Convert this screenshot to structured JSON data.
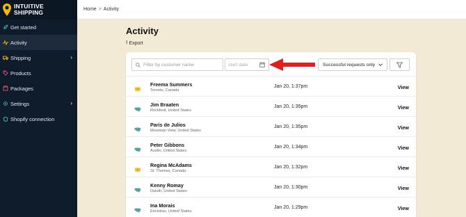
{
  "brand": {
    "line1": "INTUITIVE",
    "line2": "SHIPPING",
    "logo_icon": "location-pin-icon",
    "accent": "#f5b800"
  },
  "sidebar": {
    "items": [
      {
        "label": "Get started",
        "icon": "rocket-icon",
        "active": false,
        "chevron": false
      },
      {
        "label": "Activity",
        "icon": "activity-icon",
        "active": true,
        "chevron": false
      },
      {
        "label": "Shipping",
        "icon": "truck-icon",
        "active": false,
        "chevron": true
      },
      {
        "label": "Products",
        "icon": "tag-icon",
        "active": false,
        "chevron": false
      },
      {
        "label": "Packages",
        "icon": "box-icon",
        "active": false,
        "chevron": false
      },
      {
        "label": "Settings",
        "icon": "gear-icon",
        "active": false,
        "chevron": true
      },
      {
        "label": "Shopify connection",
        "icon": "shopify-icon",
        "active": false,
        "chevron": false
      }
    ]
  },
  "breadcrumb": {
    "home": "Home",
    "separator": ">",
    "current": "Activity"
  },
  "page": {
    "title": "Activity",
    "export_label": "Export"
  },
  "filters": {
    "search_placeholder": "Filter by customer name",
    "date_placeholder": "start date",
    "status_selected": "Successful requests only"
  },
  "rows": [
    {
      "name": "Freema Summers",
      "location": "Toronto, Canada",
      "time": "Jan 20, 1:37pm",
      "flag": "canada",
      "action": "View"
    },
    {
      "name": "Jim Braaten",
      "location": "Rockford, United States",
      "time": "Jan 20, 1:35pm",
      "flag": "usa",
      "action": "View"
    },
    {
      "name": "Paris de Julios",
      "location": "Mountain View, United States",
      "time": "Jan 20, 1:35pm",
      "flag": "usa",
      "action": "View"
    },
    {
      "name": "Peter Gibbons",
      "location": "Austin, United States",
      "time": "Jan 20, 1:34pm",
      "flag": "usa",
      "action": "View"
    },
    {
      "name": "Regina McAdams",
      "location": "St. Thomas, Canada",
      "time": "Jan 20, 1:32pm",
      "flag": "canada",
      "action": "View"
    },
    {
      "name": "Kenny Romay",
      "location": "Duluth, United States",
      "time": "Jan 20, 1:30pm",
      "flag": "usa",
      "action": "View"
    },
    {
      "name": "Ina Morais",
      "location": "Encinitas, United States",
      "time": "Jan 20, 1:29pm",
      "flag": "usa",
      "action": "View"
    }
  ],
  "colors": {
    "sidebar_bg": "#0d1b2a",
    "page_bg": "#f3ead6",
    "arrow": "#e31e1e",
    "usa_icon": "#5aa0a2",
    "canada_icon": "#f2c12e"
  }
}
